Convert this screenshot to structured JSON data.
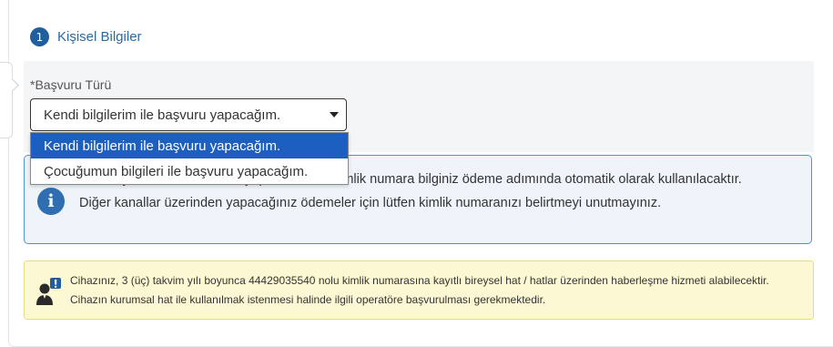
{
  "step": {
    "number": "1",
    "title": "Kişisel Bilgiler"
  },
  "application_type": {
    "required_mark": "*",
    "label": "Başvuru Türü",
    "selected_value": "Kendi bilgilerim ile başvuru yapacağım.",
    "options": [
      "Kendi bilgilerim ile başvuru yapacağım.",
      "Çocuğumun bilgileri ile başvuru yapacağım."
    ]
  },
  "info": {
    "icon": "info-icon",
    "text": "Ödemeyi internet üzerinden yapacaksanız, kimlik numara bilginiz ödeme adımında otomatik olarak kullanılacaktır. Diğer kanallar üzerinden yapacağınız ödemeler için lütfen kimlik numaranızı belirtmeyi unutmayınız."
  },
  "notice": {
    "icon": "user-alert-icon",
    "text": "Cihazınız, 3 (üç) takvim yılı boyunca 44429035540 nolu kimlik numarasına kayıtlı bireysel hat / hatlar üzerinden haberleşme hizmeti alabilecektir. Cihazın kurumsal hat ile kullanılmak istenmesi halinde ilgili operatöre başvurulması gerekmektedir."
  },
  "colors": {
    "accent": "#1f5f9e",
    "selected_option": "#1d5fc1",
    "info_border": "#5b8fbf",
    "warning_bg": "#fdf8d4"
  }
}
